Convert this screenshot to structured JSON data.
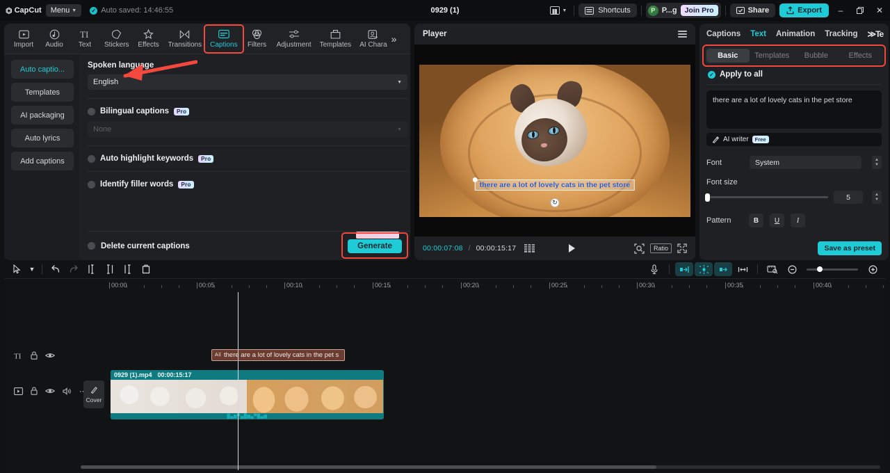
{
  "titlebar": {
    "brand": "CapCut",
    "menu_label": "Menu",
    "autosave": "Auto saved: 14:46:55",
    "project_title": "0929 (1)",
    "layout_icon": "layout-icon",
    "shortcuts_label": "Shortcuts",
    "user_initial": "P",
    "user_name": "P...g",
    "join_pro_label": "Join Pro",
    "share_label": "Share",
    "export_label": "Export",
    "minimize": "–",
    "maximize": "❐",
    "close": "✕"
  },
  "tool_tabs": [
    {
      "label": "Import",
      "icon": "import-icon",
      "active": false
    },
    {
      "label": "Audio",
      "icon": "audio-icon",
      "active": false
    },
    {
      "label": "Text",
      "icon": "text-icon",
      "active": false
    },
    {
      "label": "Stickers",
      "icon": "stickers-icon",
      "active": false
    },
    {
      "label": "Effects",
      "icon": "effects-icon",
      "active": false
    },
    {
      "label": "Transitions",
      "icon": "transitions-icon",
      "active": false
    },
    {
      "label": "Captions",
      "icon": "captions-icon",
      "active": true
    },
    {
      "label": "Filters",
      "icon": "filters-icon",
      "active": false
    },
    {
      "label": "Adjustment",
      "icon": "adjustment-icon",
      "active": false
    },
    {
      "label": "Templates",
      "icon": "templates-icon",
      "active": false
    },
    {
      "label": "AI Chara",
      "icon": "ai-character-icon",
      "active": false
    }
  ],
  "sub_nav": [
    {
      "label": "Auto captio...",
      "active": true
    },
    {
      "label": "Templates",
      "active": false
    },
    {
      "label": "AI packaging",
      "active": false
    },
    {
      "label": "Auto lyrics",
      "active": false
    },
    {
      "label": "Add captions",
      "active": false
    }
  ],
  "captions_settings": {
    "spoken_language_label": "Spoken language",
    "spoken_language_value": "English",
    "bilingual_label": "Bilingual captions",
    "bilingual_badge": "Pro",
    "bilingual_value": "None",
    "auto_highlight_label": "Auto highlight keywords",
    "auto_highlight_badge": "Pro",
    "filler_words_label": "Identify filler words",
    "filler_words_badge": "Pro",
    "delete_current_label": "Delete current captions",
    "generate_label": "Generate"
  },
  "player": {
    "title": "Player",
    "caption_overlay": "there are a lot of lovely cats in the pet store",
    "current_time": "00:00:07:08",
    "time_separator": "/",
    "total_time": "00:00:15:17",
    "ratio_label": "Ratio",
    "play_icon": "play-icon",
    "frames_icon": "frames-icon",
    "zoom_icon": "magnifier-icon",
    "fullscreen_icon": "fullscreen-icon"
  },
  "right_panel": {
    "tabs": [
      {
        "label": "Captions",
        "active": false
      },
      {
        "label": "Text",
        "active": true
      },
      {
        "label": "Animation",
        "active": false
      },
      {
        "label": "Tracking",
        "active": false
      }
    ],
    "more_label": "≫Te",
    "segments": [
      {
        "label": "Basic",
        "active": true
      },
      {
        "label": "Templates",
        "active": false
      },
      {
        "label": "Bubble",
        "active": false
      },
      {
        "label": "Effects",
        "active": false
      }
    ],
    "apply_to_all": "Apply to all",
    "text_value": "there are a lot of lovely cats in the pet store",
    "ai_writer_label": "AI writer",
    "ai_writer_badge": "Free",
    "font_label": "Font",
    "font_value": "System",
    "font_size_label": "Font size",
    "font_size_value": "5",
    "pattern_label": "Pattern",
    "bold_label": "B",
    "underline_label": "U",
    "italic_label": "I",
    "save_preset_label": "Save as preset"
  },
  "timeline": {
    "tools": [
      {
        "name": "select-tool",
        "glyph": "➤"
      },
      {
        "name": "select-dropdown",
        "glyph": "⌄"
      },
      {
        "name": "undo",
        "glyph": "↶"
      },
      {
        "name": "redo",
        "glyph": "↷"
      },
      {
        "name": "split",
        "glyph": "⍠"
      },
      {
        "name": "trim-left",
        "glyph": "⍠"
      },
      {
        "name": "trim-right",
        "glyph": "⍠"
      },
      {
        "name": "delete",
        "glyph": "⌧"
      }
    ],
    "right_tools": [
      {
        "name": "microphone",
        "glyph": "⬤"
      },
      {
        "name": "keyframe-prev",
        "glyph": "◀"
      },
      {
        "name": "keyframe-add",
        "glyph": "✦"
      },
      {
        "name": "keyframe-next",
        "glyph": "▶"
      },
      {
        "name": "split-marker",
        "glyph": "⌶"
      },
      {
        "name": "crop",
        "glyph": "▣"
      },
      {
        "name": "zoom-out",
        "glyph": "−"
      },
      {
        "name": "zoom-in",
        "glyph": "+"
      }
    ],
    "ruler_ticks": [
      "00:00",
      "00:05",
      "00:10",
      "00:15",
      "00:20",
      "00:25",
      "00:30",
      "00:35",
      "00:40"
    ],
    "text_clip_label": "there are a lot of lovely cats in the pet s",
    "text_clip_icon": "text-clip-icon",
    "video_clip_name": "0929 (1).mp4",
    "video_clip_duration": "00:00:15:17",
    "cover_label": "Cover",
    "cover_icon": "pencil-icon",
    "text_track_icons": [
      "text-track-icon",
      "lock-icon",
      "eye-icon"
    ],
    "video_track_icons": [
      "video-track-icon",
      "lock-icon",
      "eye-icon",
      "volume-icon",
      "more-icon"
    ]
  },
  "colors": {
    "accent": "#1fcbd6",
    "highlight": "#f2483e",
    "panel": "#1e2023",
    "background": "#111214",
    "caption_text": "#2557c9"
  }
}
